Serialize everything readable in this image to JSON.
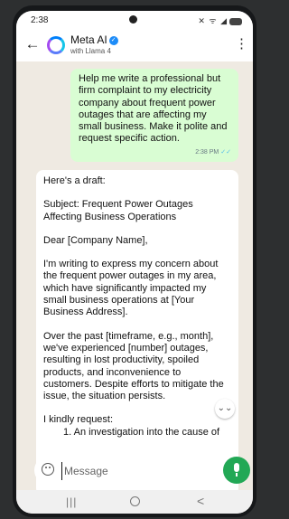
{
  "status_bar": {
    "time": "2:38",
    "icons": "✕ ᯤ ◢"
  },
  "header": {
    "back_glyph": "←",
    "title": "Meta AI",
    "verified_glyph": "✓",
    "subtitle": "with Llama 4",
    "menu_glyph": "⋮",
    "logo_icon": "meta-ai-ring-icon"
  },
  "messages": {
    "user": {
      "text": "Help me write a professional but firm complaint to my electricity company about frequent power outages that are affecting my small business. Make it polite and request specific action.",
      "time": "2:38 PM",
      "ticks": "✓✓"
    },
    "ai": {
      "intro": "Here's a draft:",
      "subject": "Subject: Frequent Power Outages Affecting Business Operations",
      "salutation": "Dear [Company Name],",
      "para1": "I'm writing to express my concern about the frequent power outages in my area, which have significantly impacted my small business operations at [Your Business Address].",
      "para2": "Over the past [timeframe, e.g., month], we've experienced [number] outages, resulting in lost productivity, spoiled products, and inconvenience to customers. Despite efforts to mitigate the issue, the situation persists.",
      "request": "I kindly request:",
      "list_item1": "An investigation into the cause of"
    }
  },
  "scroll_button_glyph": "⌄⌄",
  "composer": {
    "placeholder": "Message",
    "emoji_icon": "emoji-icon",
    "mic_icon": "mic-icon",
    "accent_color": "#22a855"
  },
  "nav_bar": {
    "recents_glyph": "|||",
    "back_glyph": "<"
  }
}
